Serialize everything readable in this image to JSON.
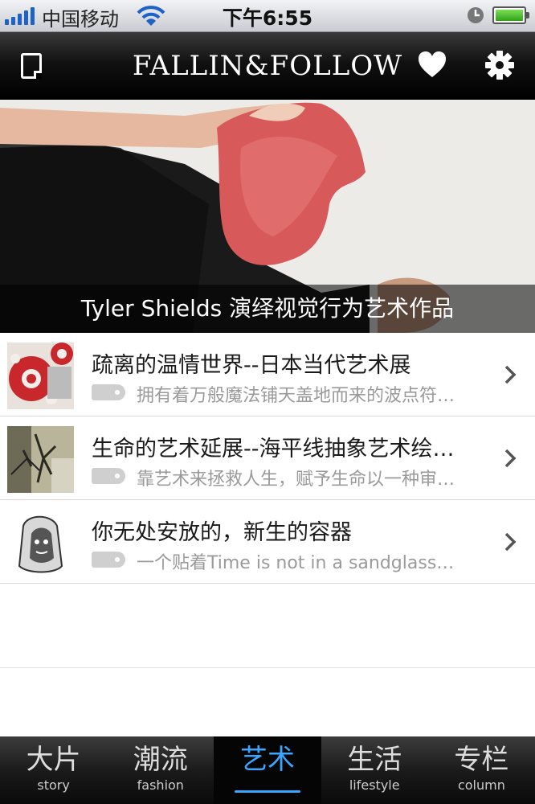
{
  "status_bar": {
    "carrier": "中国移动",
    "time": "下午6:55"
  },
  "nav": {
    "logo": "FALLIN&FOLLOW"
  },
  "banner": {
    "caption": "Tyler Shields 演绎视觉行为艺术作品"
  },
  "articles": [
    {
      "title": "疏离的温情世界--日本当代艺术展",
      "subtitle": "拥有着万般魔法铺天盖地而来的波点符…"
    },
    {
      "title": "生命的艺术延展--海平线抽象艺术绘…",
      "subtitle": "靠艺术来拯救人生，赋予生命以一种审…"
    },
    {
      "title": "你无处安放的，新生的容器",
      "subtitle": "一个贴着Time is not in a sandglass…"
    }
  ],
  "tabs": [
    {
      "cn": "大片",
      "en": "story",
      "active": false
    },
    {
      "cn": "潮流",
      "en": "fashion",
      "active": false
    },
    {
      "cn": "艺术",
      "en": "",
      "active": true
    },
    {
      "cn": "生活",
      "en": "lifestyle",
      "active": false
    },
    {
      "cn": "专栏",
      "en": "column",
      "active": false
    }
  ],
  "colors": {
    "accent": "#3aa6ff",
    "signal": "#1d62c7",
    "battery": "#3cb521"
  }
}
